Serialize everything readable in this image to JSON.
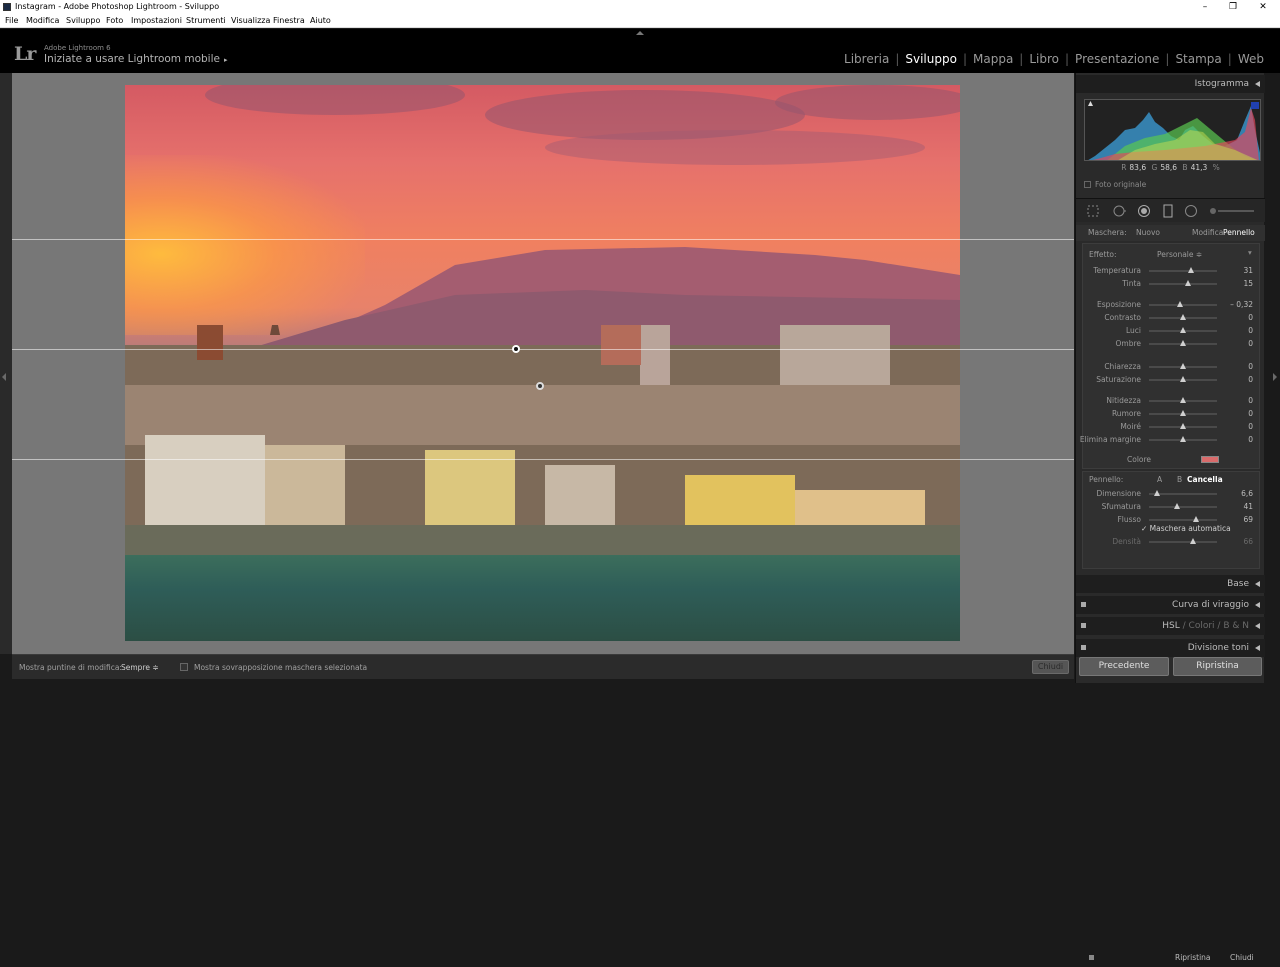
{
  "window": {
    "title": "Instagram - Adobe Photoshop Lightroom - Sviluppo",
    "controls": [
      "–",
      "❐",
      "✕"
    ]
  },
  "menu": [
    "File",
    "Modifica",
    "Sviluppo",
    "Foto",
    "Impostazioni",
    "Strumenti",
    "Visualizza",
    "Finestra",
    "Aiuto"
  ],
  "identity": {
    "logo": "Lr",
    "product": "Adobe Lightroom 6",
    "mobile_label": "Iniziate a usare Lightroom mobile",
    "mobile_arrow": "▸"
  },
  "modules": [
    {
      "label": "Libreria",
      "active": false
    },
    {
      "label": "Sviluppo",
      "active": true
    },
    {
      "label": "Mappa",
      "active": false
    },
    {
      "label": "Libro",
      "active": false
    },
    {
      "label": "Presentazione",
      "active": false
    },
    {
      "label": "Stampa",
      "active": false
    },
    {
      "label": "Web",
      "active": false
    }
  ],
  "toolbar": {
    "show_pins_label": "Mostra puntine di modifica:",
    "show_pins_value": "Sempre ≑",
    "overlay_label": "Mostra sovrapposizione maschera selezionata",
    "close_label": "Chiudi"
  },
  "panels": {
    "histogram_title": "Istogramma",
    "rgb": {
      "r_label": "R",
      "r": "83,6",
      "g_label": "G",
      "g": "58,6",
      "b_label": "B",
      "b": "41,3",
      "unit": "%"
    },
    "original_photo": "Foto originale",
    "mask_label": "Maschera:",
    "mask_new": "Nuovo",
    "mask_edit": "Modifica",
    "mask_brush": "Pennello",
    "effect_label": "Effetto:",
    "effect_value": "Personale ≑",
    "sliders": [
      {
        "label": "Temperatura",
        "value": "31",
        "pos": 0.62
      },
      {
        "label": "Tinta",
        "value": "15",
        "pos": 0.58
      },
      {
        "label": "Esposizione",
        "value": "– 0,32",
        "pos": 0.46
      },
      {
        "label": "Contrasto",
        "value": "0",
        "pos": 0.5
      },
      {
        "label": "Luci",
        "value": "0",
        "pos": 0.5
      },
      {
        "label": "Ombre",
        "value": "0",
        "pos": 0.5
      },
      {
        "label": "Chiarezza",
        "value": "0",
        "pos": 0.5
      },
      {
        "label": "Saturazione",
        "value": "0",
        "pos": 0.5
      },
      {
        "label": "Nitidezza",
        "value": "0",
        "pos": 0.5
      },
      {
        "label": "Rumore",
        "value": "0",
        "pos": 0.5
      },
      {
        "label": "Moiré",
        "value": "0",
        "pos": 0.5
      },
      {
        "label": "Elimina margine",
        "value": "0",
        "pos": 0.5
      }
    ],
    "color_label": "Colore",
    "color_swatch": "#d96b6b",
    "brush_label": "Pennello:",
    "brush_a": "A",
    "brush_b": "B",
    "brush_erase": "Cancella",
    "brush_sliders": [
      {
        "label": "Dimensione",
        "value": "6,6",
        "pos": 0.12
      },
      {
        "label": "Sfumatura",
        "value": "41",
        "pos": 0.41
      },
      {
        "label": "Flusso",
        "value": "69",
        "pos": 0.69
      }
    ],
    "auto_mask": "Maschera automatica",
    "density_label": "Densità",
    "density_value": "66",
    "reset_label": "Ripristina",
    "close_label": "Chiudi",
    "base_title": "Base",
    "curve_title": "Curva di viraggio",
    "hsl_title": "HSL",
    "hsl_sep1": "/",
    "hsl_colors": "Colori",
    "hsl_sep2": "/",
    "hsl_bw": "B & N",
    "split_title": "Divisione toni",
    "prev_button": "Precedente",
    "reset_button": "Ripristina"
  }
}
